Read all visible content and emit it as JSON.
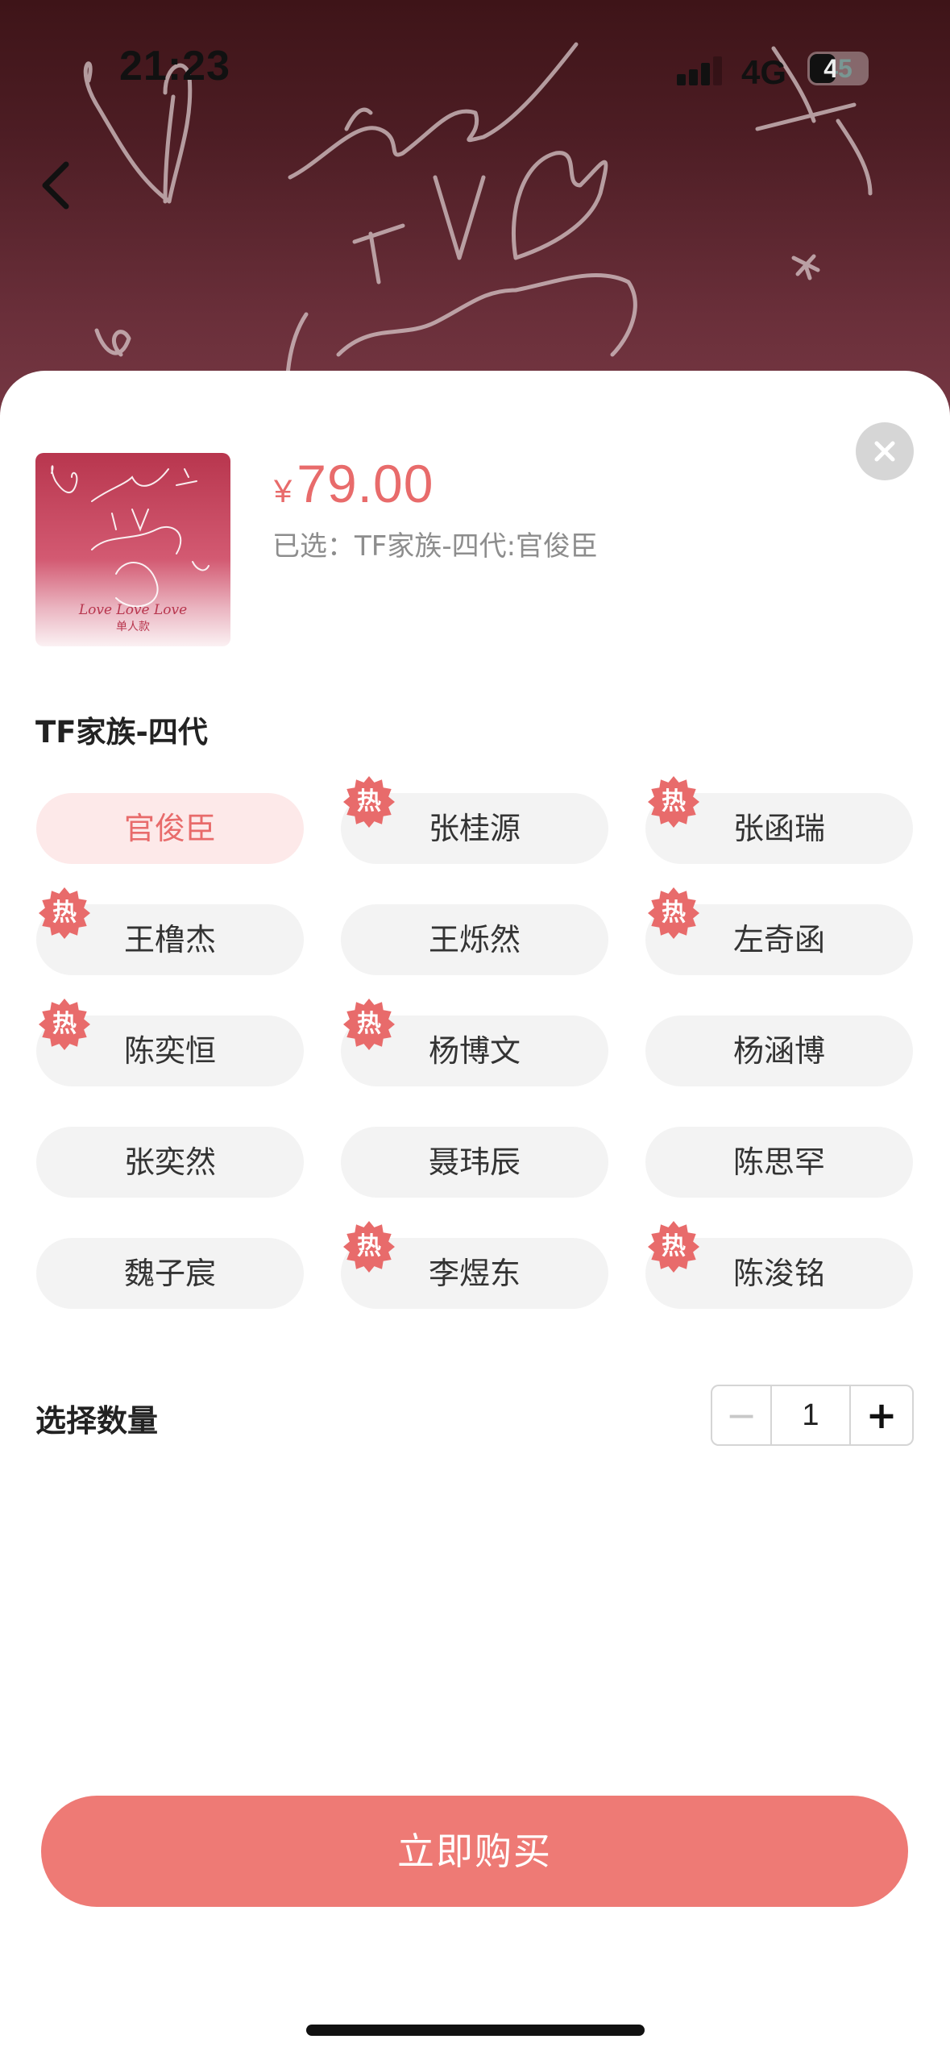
{
  "status_bar": {
    "time": "21:23",
    "network": "4G",
    "battery": "45"
  },
  "product": {
    "currency": "¥",
    "price": "79.00",
    "selected_text": "已选：TF家族-四代:官俊臣",
    "thumb_caption_1": "Love Love Love",
    "thumb_caption_2": "单人款"
  },
  "group": {
    "title": "TF家族-四代",
    "hot_label": "热",
    "options": [
      {
        "label": "官俊臣",
        "hot": false,
        "selected": true
      },
      {
        "label": "张桂源",
        "hot": true,
        "selected": false
      },
      {
        "label": "张函瑞",
        "hot": true,
        "selected": false
      },
      {
        "label": "王橹杰",
        "hot": true,
        "selected": false
      },
      {
        "label": "王烁然",
        "hot": false,
        "selected": false
      },
      {
        "label": "左奇函",
        "hot": true,
        "selected": false
      },
      {
        "label": "陈奕恒",
        "hot": true,
        "selected": false
      },
      {
        "label": "杨博文",
        "hot": true,
        "selected": false
      },
      {
        "label": "杨涵博",
        "hot": false,
        "selected": false
      },
      {
        "label": "张奕然",
        "hot": false,
        "selected": false
      },
      {
        "label": "聂玮辰",
        "hot": false,
        "selected": false
      },
      {
        "label": "陈思罕",
        "hot": false,
        "selected": false
      },
      {
        "label": "魏子宸",
        "hot": false,
        "selected": false
      },
      {
        "label": "李煜东",
        "hot": true,
        "selected": false
      },
      {
        "label": "陈浚铭",
        "hot": true,
        "selected": false
      }
    ]
  },
  "quantity": {
    "label": "选择数量",
    "value": "1",
    "minus": "−",
    "plus": "+"
  },
  "buy_button": {
    "label": "立即购买"
  },
  "colors": {
    "accent": "#e86b6b",
    "button": "#ee7a75",
    "chip_bg": "#f3f3f3",
    "chip_active_bg": "#fde9e9"
  }
}
